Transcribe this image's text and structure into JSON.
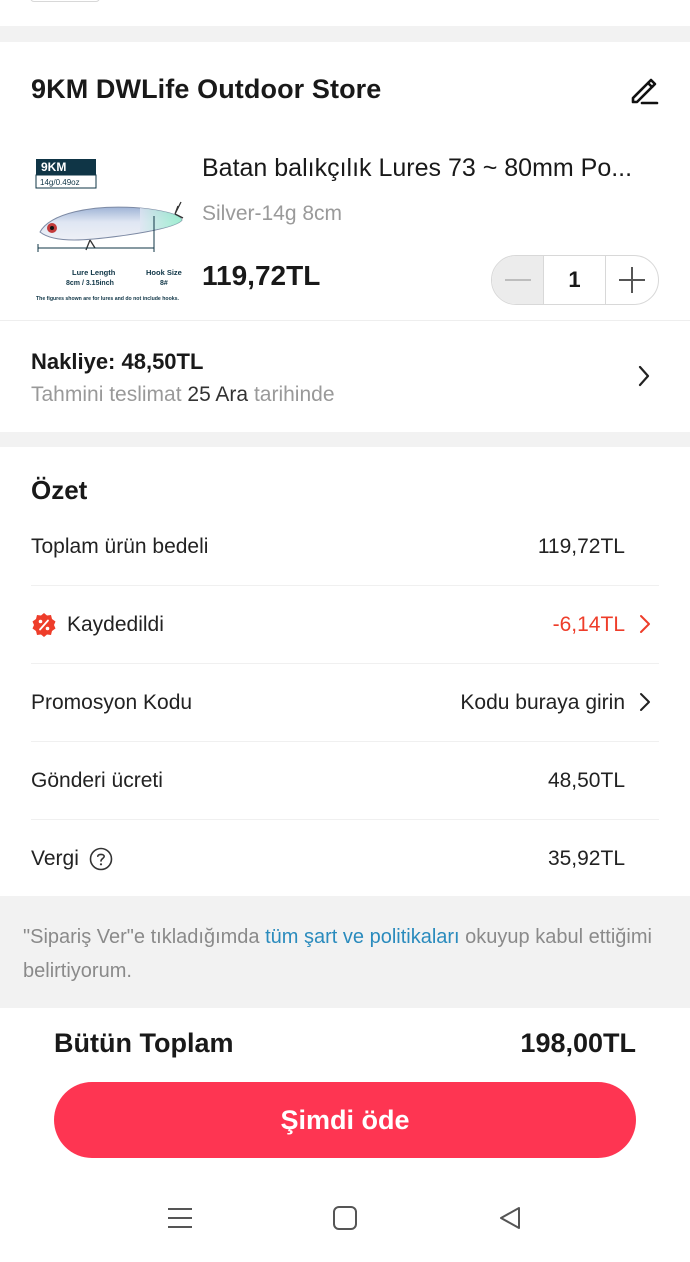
{
  "store": {
    "name": "9KM DWLife Outdoor Store"
  },
  "product": {
    "title": "Batan balıkçılık Lures 73 ~ 80mm Po...",
    "variant": "Silver-14g 8cm",
    "price": "119,72TL",
    "quantity": "1",
    "image": {
      "brand": "9KM",
      "weight": "14g/0.49oz",
      "lure_length_label": "Lure Length",
      "lure_length_value": "8cm / 3.15inch",
      "hook_size_label": "Hook Size",
      "hook_size_value": "8#",
      "footnote": "The figures shown are for lures and do not include hooks."
    }
  },
  "shipping": {
    "title": "Nakliye: 48,50TL",
    "eta_prefix": "Tahmini teslimat ",
    "eta_date": "25 Ara",
    "eta_suffix": " tarihinde"
  },
  "summary": {
    "title": "Özet",
    "rows": [
      {
        "label": "Toplam ürün bedeli",
        "value": "119,72TL"
      },
      {
        "label": "Kaydedildi",
        "value": "-6,14TL"
      },
      {
        "label": "Promosyon Kodu",
        "value": "Kodu buraya girin"
      },
      {
        "label": "Gönderi ücreti",
        "value": "48,50TL"
      },
      {
        "label": "Vergi",
        "value": "35,92TL"
      }
    ]
  },
  "terms": {
    "prefix": "\"Sipariş Ver\"e tıkladığımda ",
    "link": "tüm şart ve politikaları",
    "suffix": " okuyup kabul ettiğimi belirtiyorum."
  },
  "footer": {
    "total_label": "Bütün Toplam",
    "total_value": "198,00TL",
    "pay_button": "Şimdi öde"
  },
  "colors": {
    "accent": "#fe3552",
    "discount": "#ee3d2a",
    "link": "#2a8bbd"
  },
  "icons": {
    "edit": "edit-pencil-icon",
    "discount_badge": "percent-badge-icon",
    "help": "question-circle-icon",
    "chevron": "chevron-right-icon",
    "nav_menu": "menu-icon",
    "nav_home": "home-square-icon",
    "nav_back": "back-triangle-icon"
  }
}
